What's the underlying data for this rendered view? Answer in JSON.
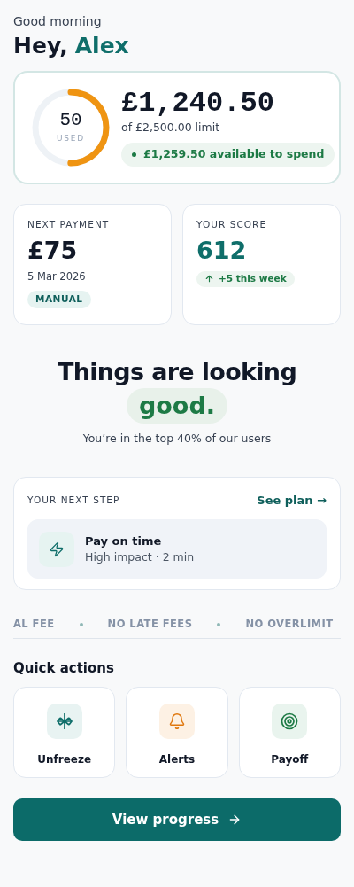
{
  "greeting": "Good morning",
  "title": {
    "prefix": "Hey,",
    "name": "Alex"
  },
  "credit": {
    "gauge": {
      "value": "50",
      "caption": "USED"
    },
    "balance": "£1,240.50",
    "limit": "of £2,500.00 limit",
    "available": "£1,259.50 available to spend"
  },
  "next_payment": {
    "label": "NEXT PAYMENT",
    "amount": "£75",
    "date": "5 Mar 2026",
    "badge": "MANUAL"
  },
  "score": {
    "label": "YOUR SCORE",
    "value": "612",
    "change": "+5 this week"
  },
  "headline": {
    "line1": "Things are looking",
    "highlight": "good.",
    "subtitle": "You’re in the top 40% of our users"
  },
  "next_step": {
    "label": "YOUR NEXT STEP",
    "link": "See plan →",
    "task": {
      "title": "Pay on time",
      "detail": "High impact · 2 min"
    }
  },
  "perks": [
    "AL FEE",
    "NO LATE FEES",
    "NO OVERLIMIT"
  ],
  "quick_actions": {
    "title": "Quick actions",
    "items": [
      {
        "kind": "unfreeze",
        "label": "Unfreeze",
        "color": "#0f6e6a"
      },
      {
        "kind": "alerts",
        "label": "Alerts",
        "color": "#e0780f"
      },
      {
        "kind": "payoff",
        "label": "Payoff",
        "color": "#1d7a45"
      }
    ]
  },
  "primary_button": "View progress"
}
